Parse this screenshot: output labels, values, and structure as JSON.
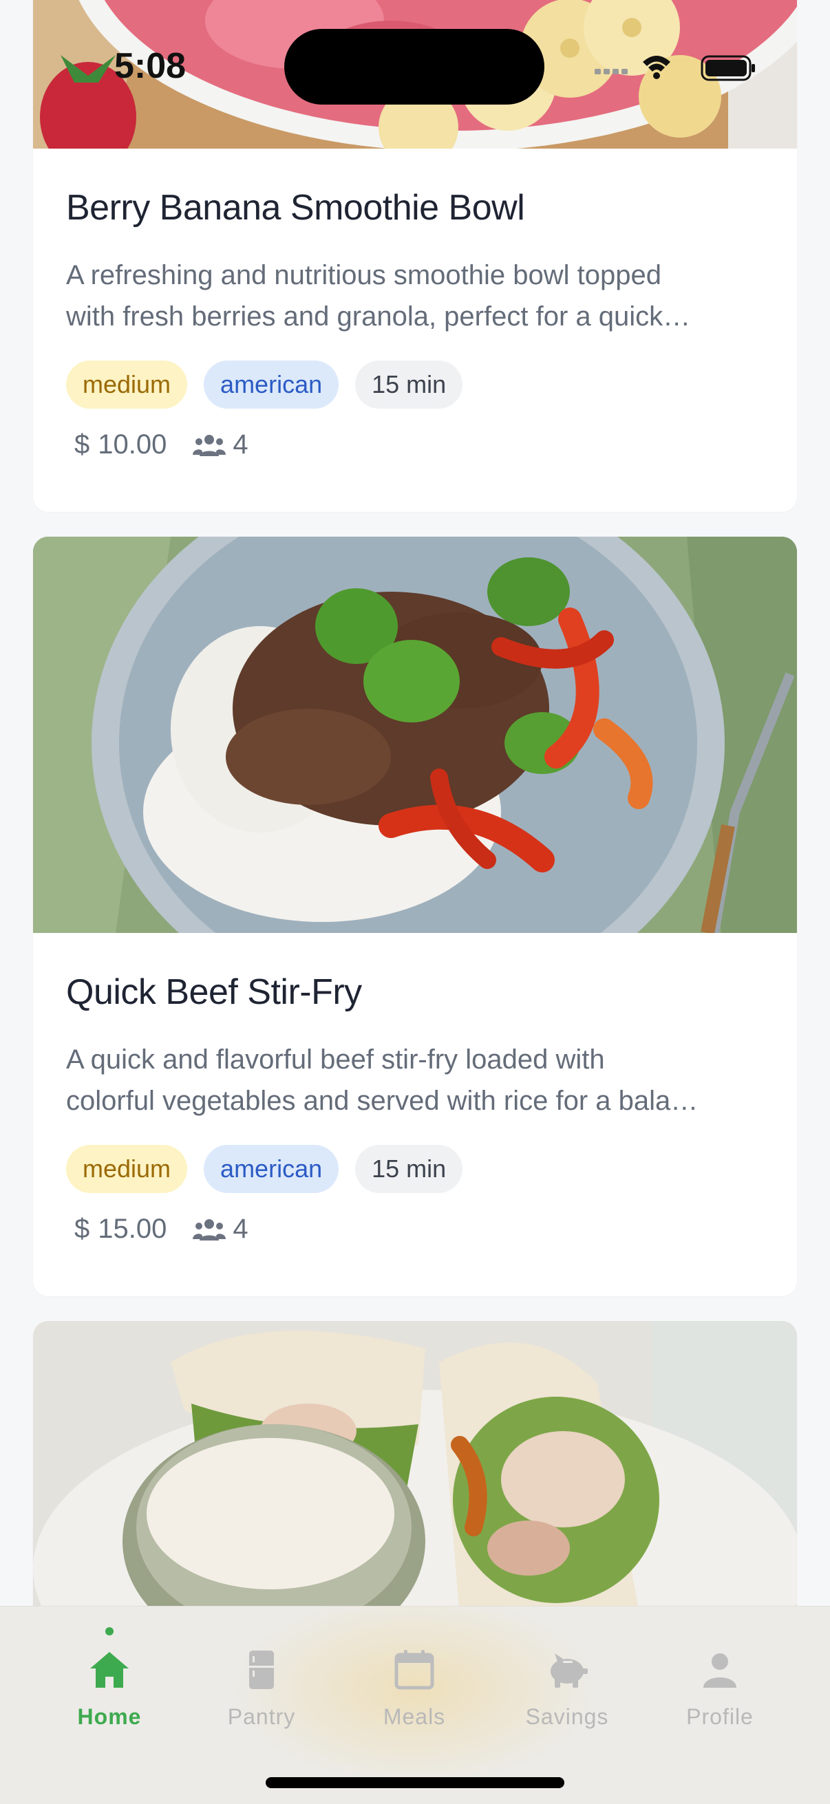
{
  "status_bar": {
    "time": "5:08"
  },
  "recipes": [
    {
      "title": "Berry Banana Smoothie Bowl",
      "description_line1": "A refreshing and nutritious smoothie bowl topped",
      "description_line2": "with fresh berries and granola, perfect for a quick…",
      "difficulty": "medium",
      "cuisine": "american",
      "time": "15 min",
      "currency": "$",
      "price": "10.00",
      "servings": "4",
      "image": "smoothie-bowl-photo"
    },
    {
      "title": "Quick Beef Stir-Fry",
      "description_line1": "A quick and flavorful beef stir-fry loaded with",
      "description_line2": "colorful vegetables and served with rice for a bala…",
      "difficulty": "medium",
      "cuisine": "american",
      "time": "15 min",
      "currency": "$",
      "price": "15.00",
      "servings": "4",
      "image": "beef-stir-fry-photo"
    },
    {
      "image": "chicken-wrap-photo"
    }
  ],
  "tab_bar": {
    "active": "Home",
    "active_color": "#3eaa4f",
    "inactive_color": "#b8b8b8",
    "items": [
      {
        "label": "Home",
        "icon": "home-icon"
      },
      {
        "label": "Pantry",
        "icon": "fridge-icon"
      },
      {
        "label": "Meals",
        "icon": "calendar-icon"
      },
      {
        "label": "Savings",
        "icon": "piggy-bank-icon"
      },
      {
        "label": "Profile",
        "icon": "person-icon"
      }
    ]
  }
}
